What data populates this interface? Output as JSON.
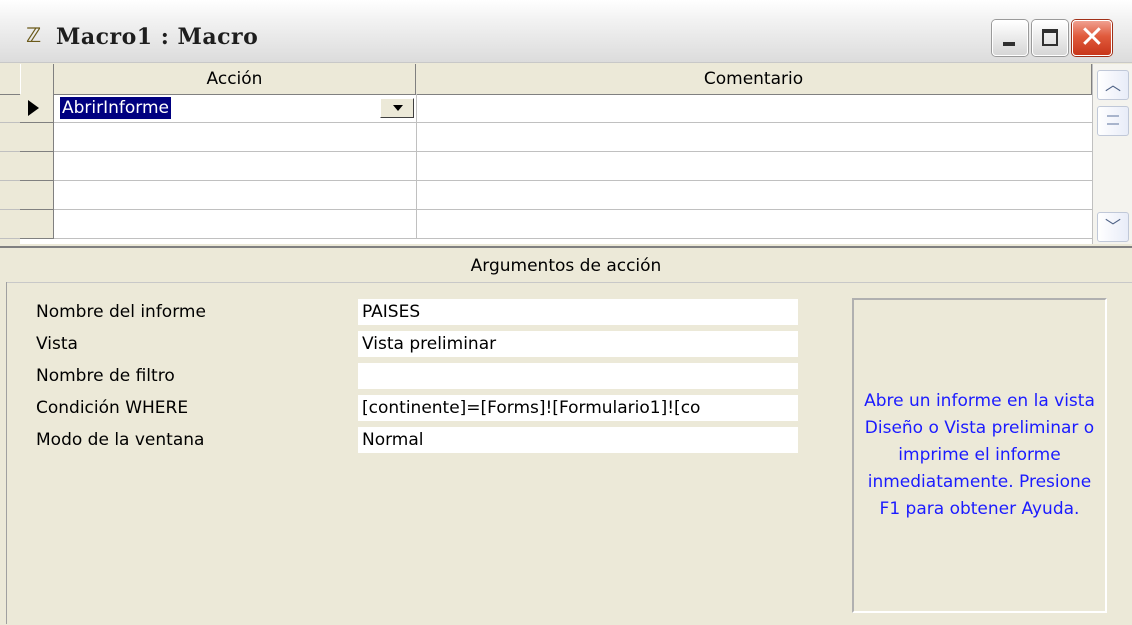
{
  "window": {
    "title": "Macro1 : Macro",
    "icon": "macro-scroll-icon",
    "controls": [
      "minimize-icon",
      "maximize-icon",
      "close-icon"
    ]
  },
  "grid": {
    "columns": [
      "Acción",
      "Comentario"
    ],
    "rows": [
      {
        "accion": "AbrirInforme",
        "comentario": "",
        "selected": true
      },
      {
        "accion": "",
        "comentario": ""
      },
      {
        "accion": "",
        "comentario": ""
      },
      {
        "accion": "",
        "comentario": ""
      },
      {
        "accion": "",
        "comentario": ""
      }
    ]
  },
  "arguments": {
    "caption": "Argumentos de acción",
    "properties": [
      {
        "label": "Nombre del informe",
        "value": "PAISES"
      },
      {
        "label": "Vista",
        "value": "Vista preliminar"
      },
      {
        "label": "Nombre de filtro",
        "value": ""
      },
      {
        "label": "Condición WHERE",
        "value": "[continente]=[Forms]![Formulario1]![co"
      },
      {
        "label": "Modo de la ventana",
        "value": "Normal"
      }
    ],
    "help_text": "Abre un informe en la vista Diseño o Vista preliminar o imprime el informe inmediatamente. Presione F1 para obtener Ayuda."
  },
  "colors": {
    "selection": "#000080",
    "help_text": "#1b1bff",
    "window_bg": "#ece9d8",
    "close_button": "#e05a3c"
  }
}
